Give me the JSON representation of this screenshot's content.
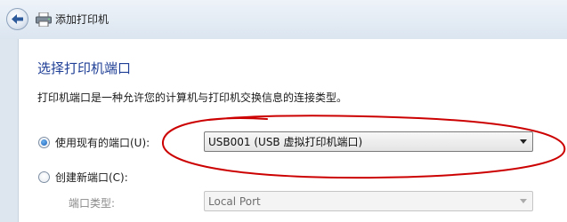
{
  "window": {
    "title": "添加打印机",
    "icons": {
      "back": "back-arrow-icon",
      "printer": "printer-icon"
    }
  },
  "page": {
    "heading": "选择打印机端口",
    "description": "打印机端口是一种允许您的计算机与打印机交换信息的连接类型。"
  },
  "options": {
    "existing_port": {
      "label": "使用现有的端口(U):",
      "selected": true,
      "value": "USB001 (USB 虚拟打印机端口)"
    },
    "new_port": {
      "label": "创建新端口(C):",
      "selected": false,
      "type_label": "端口类型:",
      "type_value": "Local Port"
    }
  },
  "colors": {
    "heading": "#1f3f96",
    "annotation_circle": "#cc0000"
  }
}
